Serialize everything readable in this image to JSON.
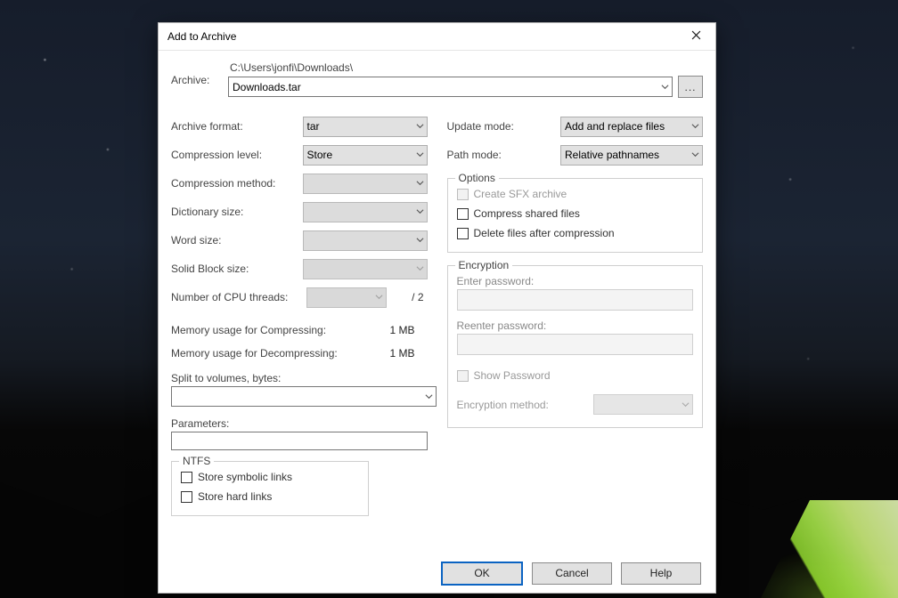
{
  "window": {
    "title": "Add to Archive"
  },
  "archive": {
    "label": "Archive:",
    "path": "C:\\Users\\jonfi\\Downloads\\",
    "filename": "Downloads.tar",
    "browse_label": "..."
  },
  "left": {
    "archive_format": {
      "label": "Archive format:",
      "value": "tar"
    },
    "compression_level": {
      "label": "Compression level:",
      "value": "Store"
    },
    "compression_method": {
      "label": "Compression method:",
      "value": ""
    },
    "dictionary_size": {
      "label": "Dictionary size:",
      "value": ""
    },
    "word_size": {
      "label": "Word size:",
      "value": ""
    },
    "solid_block_size": {
      "label": "Solid Block size:",
      "value": ""
    },
    "cpu_threads": {
      "label": "Number of CPU threads:",
      "value": "",
      "suffix": "/ 2"
    },
    "mem_compress": {
      "label": "Memory usage for Compressing:",
      "value": "1 MB"
    },
    "mem_decompress": {
      "label": "Memory usage for Decompressing:",
      "value": "1 MB"
    },
    "split_label": "Split to volumes, bytes:",
    "split_value": "",
    "params_label": "Parameters:",
    "params_value": "",
    "ntfs": {
      "legend": "NTFS",
      "symbolic": "Store symbolic links",
      "hard": "Store hard links"
    }
  },
  "right": {
    "update_mode": {
      "label": "Update mode:",
      "value": "Add and replace files"
    },
    "path_mode": {
      "label": "Path mode:",
      "value": "Relative pathnames"
    },
    "options": {
      "legend": "Options",
      "sfx": "Create SFX archive",
      "shared": "Compress shared files",
      "delete": "Delete files after compression"
    },
    "encryption": {
      "legend": "Encryption",
      "enter": "Enter password:",
      "reenter": "Reenter password:",
      "show": "Show Password",
      "method_label": "Encryption method:",
      "method_value": ""
    }
  },
  "buttons": {
    "ok": "OK",
    "cancel": "Cancel",
    "help": "Help"
  }
}
